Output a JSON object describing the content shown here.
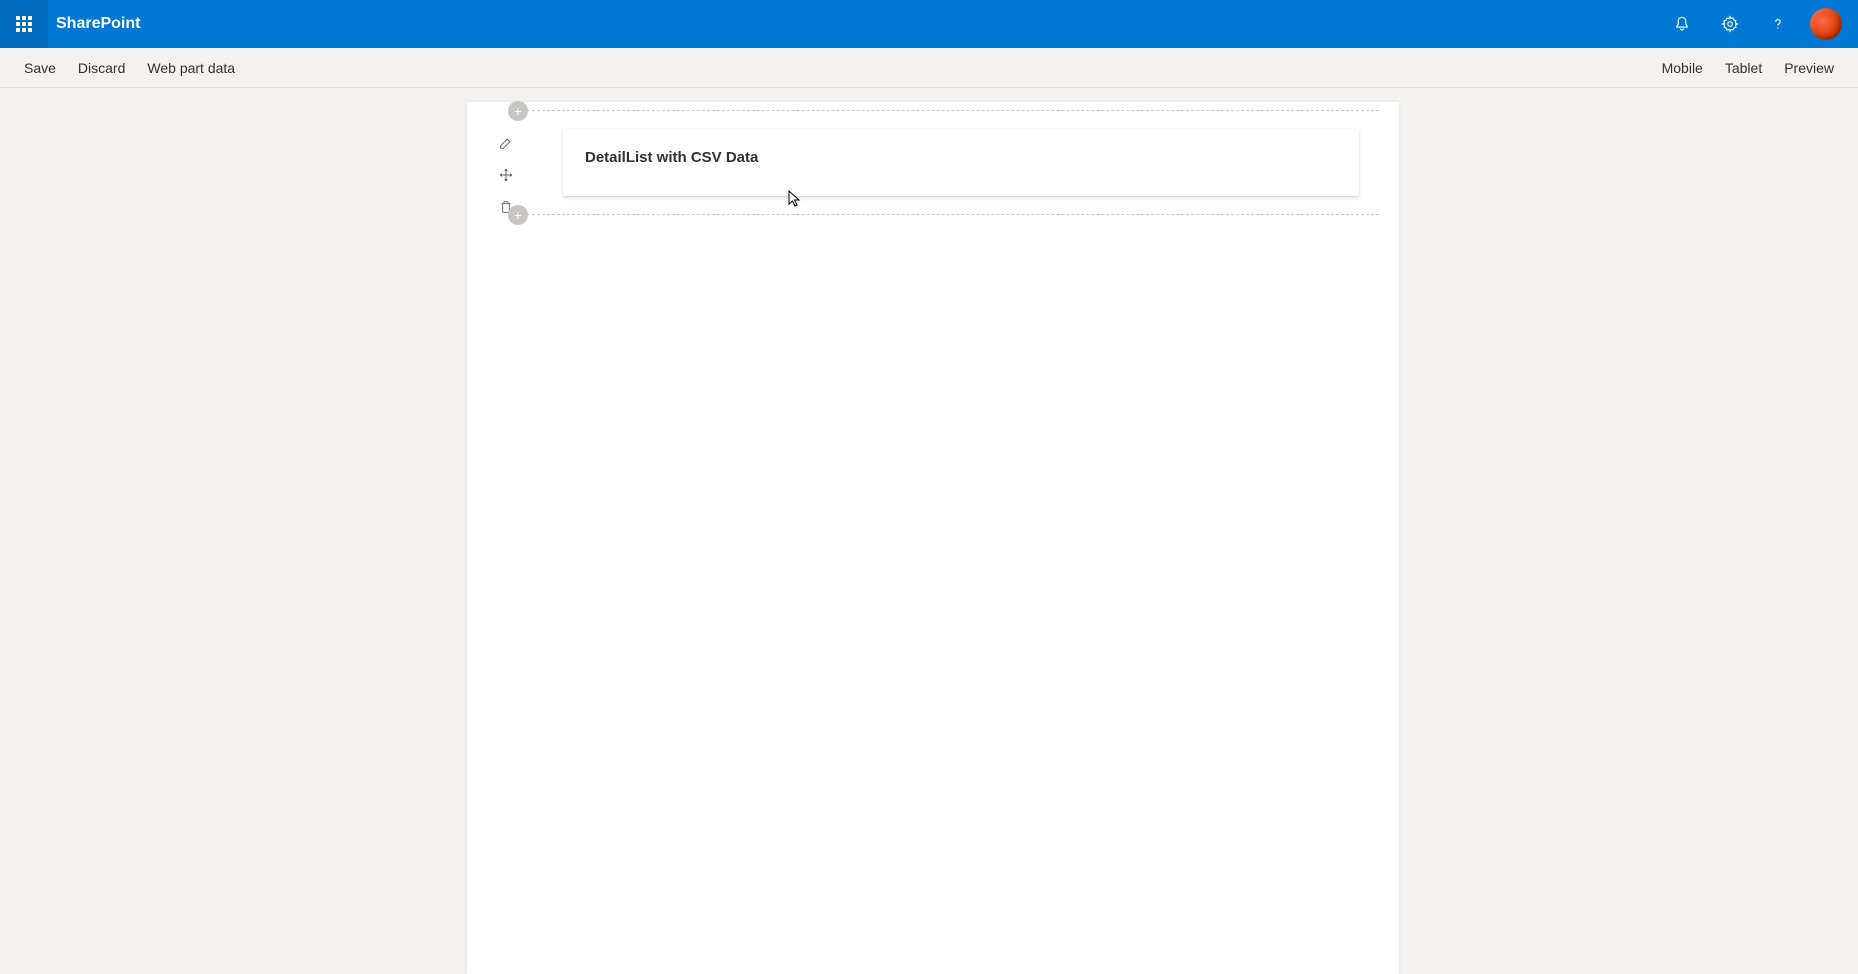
{
  "suite": {
    "app_name": "SharePoint"
  },
  "commandbar": {
    "left": {
      "save": "Save",
      "discard": "Discard",
      "webpart_data": "Web part data"
    },
    "right": {
      "mobile": "Mobile",
      "tablet": "Tablet",
      "preview": "Preview"
    }
  },
  "webpart": {
    "title": "DetailList with CSV Data"
  }
}
